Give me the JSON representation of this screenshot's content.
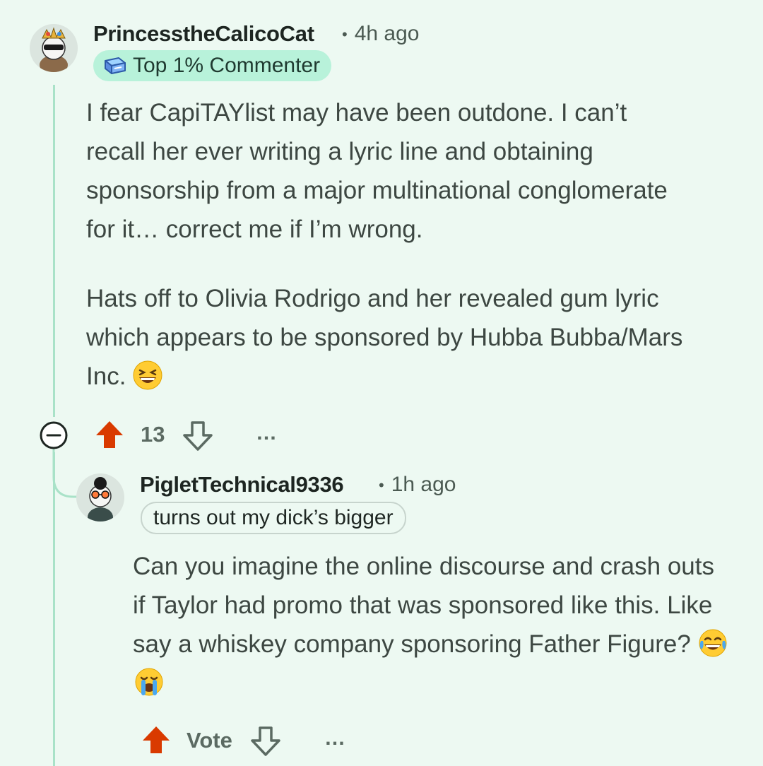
{
  "comment": {
    "username": "PrincesstheCalicoCat",
    "time": "4h ago",
    "flair": "Top 1% Commenter",
    "body": [
      "I fear CapiTAYlist may have been outdone. I can’t recall her ever writing a lyric line and obtaining sponsorship from a major multinational conglomerate for it… correct me if I’m wrong.",
      "Hats off to Olivia Rodrigo and her revealed gum lyric which appears to be sponsored by Hubba Bubba/Mars Inc."
    ],
    "vote_count": "13",
    "more": "…"
  },
  "reply": {
    "username": "PigletTechnical9336",
    "time": "1h ago",
    "flair": "turns out my dick’s bigger",
    "body": "Can you imagine the online discourse and crash outs if Taylor had promo that was sponsored like this. Like say a whiskey company sponsoring Father Figure?",
    "vote_label": "Vote",
    "more": "…"
  },
  "colors": {
    "background": "#edf9f2",
    "thread_line": "#a9e2c8",
    "upvote_active": "#d93a00",
    "flair_highlight": "#b8f2da"
  },
  "icons": {
    "collapse": "collapse-minus-icon",
    "upvote": "upvote-arrow-icon",
    "downvote": "downvote-arrow-icon",
    "more": "more-dots-icon",
    "flair_badge": "top-commenter-badge-icon",
    "emoji_laugh": "grinning-squinting-emoji",
    "emoji_tears": "tears-of-joy-emoji",
    "emoji_crying": "loudly-crying-emoji"
  }
}
